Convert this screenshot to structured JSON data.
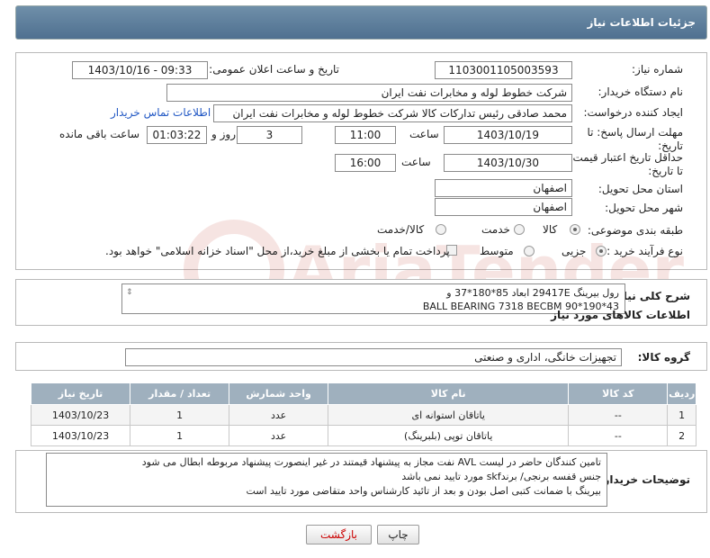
{
  "header": {
    "title": "جزئیات اطلاعات نیاز"
  },
  "form": {
    "need_number_label": "شماره نیاز:",
    "need_number": "1103001105003593",
    "announce_label": "تاریخ و ساعت اعلان عمومی:",
    "announce_value": "1403/10/16 - 09:33",
    "buyer_org_label": "نام دستگاه خریدار:",
    "buyer_org": "شرکت خطوط لوله و مخابرات نفت ایران",
    "creator_label": "ایجاد کننده درخواست:",
    "creator": "محمد صادقی رئیس تدارکات کالا  شرکت خطوط لوله و مخابرات نفت ایران",
    "contact_link": "اطلاعات تماس خریدار",
    "deadline_label": "مهلت ارسال پاسخ: تا تاریخ:",
    "deadline_date": "1403/10/19",
    "time_label": "ساعت",
    "deadline_time": "11:00",
    "days_value": "3",
    "days_label": "روز و",
    "remaining_value": "01:03:22",
    "remaining_label": "ساعت باقی مانده",
    "price_validity_label": "حداقل تاریخ اعتبار قیمت: تا تاریخ:",
    "price_validity_date": "1403/10/30",
    "price_time_label": "ساعت",
    "price_validity_time": "16:00",
    "province_label": "استان محل تحویل:",
    "province": "اصفهان",
    "city_label": "شهر محل تحویل:",
    "city": "اصفهان",
    "category_label": "طبقه بندی موضوعی:",
    "category_options": [
      "کالا",
      "خدمت",
      "کالا/خدمت"
    ],
    "category_selected": "کالا",
    "process_label": "نوع فرآیند خرید :",
    "process_options": [
      "جزیی",
      "متوسط"
    ],
    "process_selected": "جزیی",
    "payment_note": "پرداخت تمام یا بخشی از مبلغ خرید،از محل \"اسناد خزانه اسلامی\" خواهد بود."
  },
  "summary": {
    "label": "شرح کلی نیاز:",
    "line1": "رول بیرینگ  29417E   ابعاد 85*180*37 و",
    "line2": "BALL BEARING 7318 BECBM   90*190*43"
  },
  "goods_section_title": "اطلاعات کالاهای مورد نیاز",
  "goods_group": {
    "label": "گروه کالا:",
    "value": "تجهیزات خانگی، اداری و صنعتی"
  },
  "table": {
    "headers": [
      "ردیف",
      "کد کالا",
      "نام کالا",
      "واحد شمارش",
      "تعداد / مقدار",
      "تاریخ نیاز"
    ],
    "rows": [
      [
        "1",
        "--",
        "یاتاقان استوانه ای",
        "عدد",
        "1",
        "1403/10/23"
      ],
      [
        "2",
        "--",
        "یاتاقان توپی (بلبرینگ)",
        "عدد",
        "1",
        "1403/10/23"
      ]
    ]
  },
  "buyer_notes": {
    "label": "توضیحات خریدار:",
    "line1": "تامین کنندگان  حاضر در لیست  AVL نفت مجاز به پیشنهاد قیمتند در غیر اینصورت پیشنهاد مربوطه ابطال می شود",
    "line2": "جنس قفسه برنجی/ برندskf مورد تایید نمی  باشد",
    "line3": "بیرینگ با ضمانت کتبی اصل بودن و بعد از تائید کارشناس واحد متقاضی مورد تایید است"
  },
  "buttons": {
    "print": "چاپ",
    "back": "بازگشت"
  },
  "watermark": {
    "text": "AriaTender.neT"
  }
}
